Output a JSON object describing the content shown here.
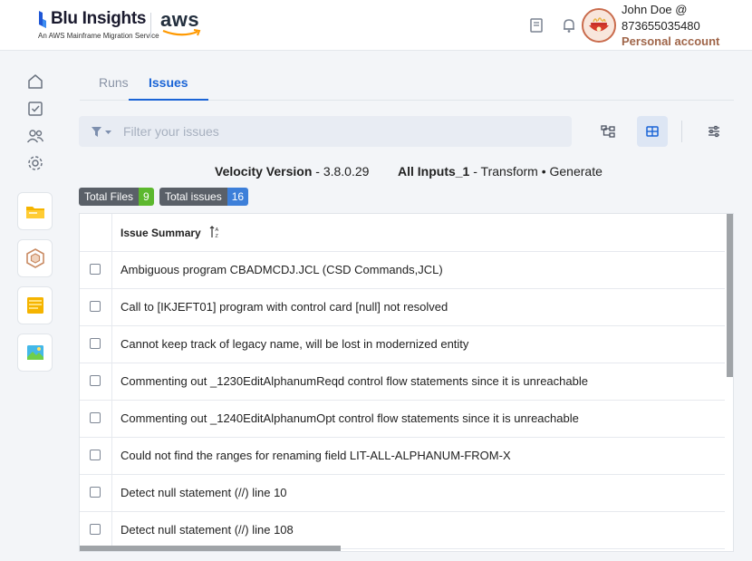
{
  "brand": {
    "name": "Blu Insights",
    "tagline": "An AWS Mainframe Migration Service",
    "partner": "aws",
    "accent": "#1a64d6"
  },
  "header": {
    "icons": [
      "book-icon",
      "bell-icon"
    ],
    "user": {
      "name": "John Doe @",
      "id": "873655035480",
      "account": "Personal account"
    }
  },
  "sidebar": {
    "nav": [
      "home-icon",
      "checklist-icon",
      "users-icon",
      "gear-icon"
    ],
    "apps": [
      "folder-app-icon",
      "transform-app-icon",
      "notes-app-icon",
      "image-app-icon"
    ]
  },
  "tabs": [
    {
      "label": "Runs",
      "active": false
    },
    {
      "label": "Issues",
      "active": true
    }
  ],
  "filter": {
    "placeholder": "Filter your issues"
  },
  "info": {
    "velocity_label": "Velocity Version",
    "velocity_value": " - 3.8.0.29",
    "inputs_label": "All Inputs_1",
    "inputs_value": " - Transform • Generate"
  },
  "badges": {
    "files_label": "Total Files",
    "files_count": "9",
    "files_color": "#5cb82e",
    "issues_label": "Total issues",
    "issues_count": "16",
    "issues_color": "#3d7fd9"
  },
  "table": {
    "header": "Issue Summary",
    "rows": [
      "Ambiguous program CBADMCDJ.JCL (CSD Commands,JCL)",
      "Call to [IKJEFT01] program with control card [null] not resolved",
      "Cannot keep track of legacy name, will be lost in modernized entity",
      "Commenting out _1230EditAlphanumReqd control flow statements since it is unreachable",
      "Commenting out _1240EditAlphanumOpt control flow statements since it is unreachable",
      "Could not find the ranges for renaming field LIT-ALL-ALPHANUM-FROM-X",
      "Detect null statement (//) line 10",
      "Detect null statement (//) line 108"
    ]
  }
}
